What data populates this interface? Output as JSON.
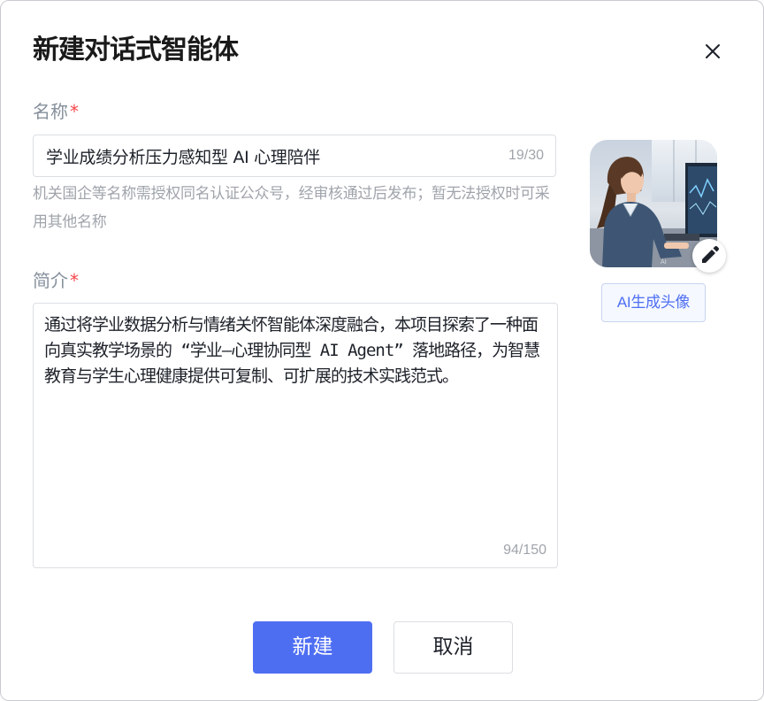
{
  "dialog": {
    "title": "新建对话式智能体",
    "close_icon": "close-icon"
  },
  "name_field": {
    "label": "名称",
    "required_mark": "*",
    "value": "学业成绩分析压力感知型 AI 心理陪伴",
    "counter": "19/30",
    "hint": "机关国企等名称需授权同名认证公众号，经审核通过后发布；暂无法授权时可采用其他名称"
  },
  "description_field": {
    "label": "简介",
    "required_mark": "*",
    "value": "通过将学业数据分析与情绪关怀智能体深度融合，本项目探索了一种面向真实教学场景的 “学业—心理协同型 AI Agent” 落地路径，为智慧教育与学生心理健康提供可复制、可扩展的技术实践范式。",
    "counter": "94/150"
  },
  "avatar": {
    "image": "avatar-image-student-at-computer",
    "edit_icon": "pencil-icon",
    "generate_button": "AI生成头像"
  },
  "footer": {
    "create_button": "新建",
    "cancel_button": "取消"
  },
  "colors": {
    "primary": "#4e6ef2",
    "required": "#f5484d",
    "label": "#86909c",
    "hint": "#a0a4ab",
    "text": "#1d2129"
  }
}
